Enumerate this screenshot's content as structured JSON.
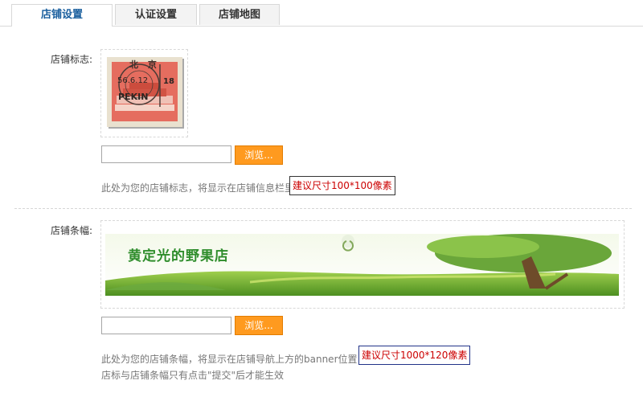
{
  "tabs": [
    {
      "label": "店铺设置",
      "active": true
    },
    {
      "label": "认证设置",
      "active": false
    },
    {
      "label": "店铺地图",
      "active": false
    }
  ],
  "logo_section": {
    "label": "店铺标志:",
    "stamp_text": {
      "top": "北 京",
      "date": "56.6.12",
      "hour": "18",
      "city": "PEKIN"
    },
    "browse_label": "浏览...",
    "hint": "此处为您的店铺标志，将显示在店铺信息栏里",
    "recommend": "建议尺寸100*100像素"
  },
  "banner_section": {
    "label": "店铺条幅:",
    "banner_text": "黄定光的野果店",
    "browse_label": "浏览...",
    "hint": "此处为您的店铺条幅，将显示在店铺导航上方的banner位置，",
    "recommend": "建议尺寸1000*120像素",
    "note": "店标与店铺条幅只有点击\"提交\"后才能生效"
  },
  "colors": {
    "tab_active_text": "#1a5f9e",
    "button_bg": "#ff9a1f",
    "recommend_text": "#cc0000",
    "banner_text": "#2f8d2c"
  }
}
